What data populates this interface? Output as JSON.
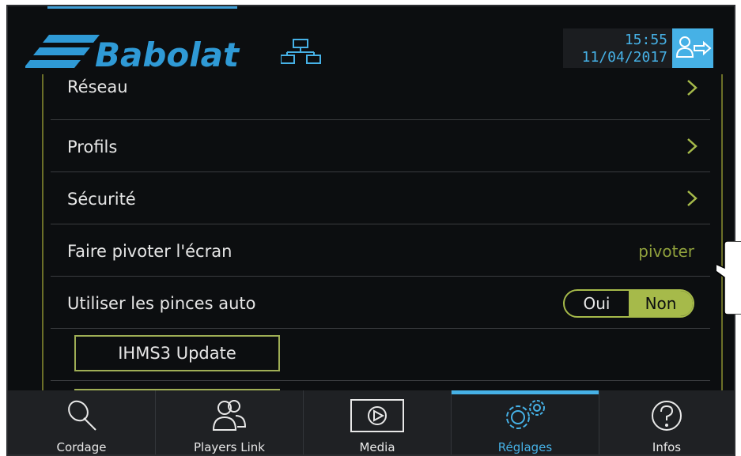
{
  "header": {
    "brand": "Babolat",
    "time": "15:55",
    "date": "11/04/2017"
  },
  "settings": {
    "rows": [
      {
        "label": "Réseau"
      },
      {
        "label": "Profils"
      },
      {
        "label": "Sécurité"
      },
      {
        "label": "Faire pivoter l'écran",
        "value": "pivoter"
      },
      {
        "label": "Utiliser les pinces auto",
        "toggle": {
          "yes": "Oui",
          "no": "Non",
          "selected": "Non"
        }
      }
    ],
    "update_button": "IHMS3 Update"
  },
  "tabs": [
    {
      "label": "Cordage",
      "icon": "racket-icon"
    },
    {
      "label": "Players Link",
      "icon": "players-icon"
    },
    {
      "label": "Media",
      "icon": "play-icon"
    },
    {
      "label": "Réglages",
      "icon": "gears-icon",
      "active": true
    },
    {
      "label": "Infos",
      "icon": "question-icon"
    }
  ],
  "colors": {
    "accent_blue": "#46b1e6",
    "accent_green": "#a6ba4a",
    "background": "#0c0e10"
  }
}
